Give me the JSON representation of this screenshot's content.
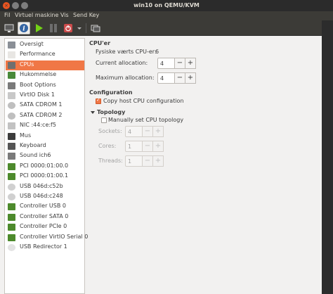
{
  "window": {
    "title": "win10 on QEMU/KVM"
  },
  "menu": [
    "Fil",
    "Virtuel maskine",
    "Vis",
    "Send Key"
  ],
  "toolbar": {
    "buttons": [
      "monitor-icon",
      "info-icon",
      "play-icon",
      "pause-icon",
      "power-icon",
      "dropdown-icon",
      "screenshot-icon"
    ]
  },
  "sidebar": {
    "items": [
      {
        "label": "Oversigt",
        "icon": "overview-icon"
      },
      {
        "label": "Performance",
        "icon": "performance-icon"
      },
      {
        "label": "CPUs",
        "icon": "cpu-icon"
      },
      {
        "label": "Hukommelse",
        "icon": "memory-icon"
      },
      {
        "label": "Boot Options",
        "icon": "boot-icon"
      },
      {
        "label": "VirtIO Disk 1",
        "icon": "disk-icon"
      },
      {
        "label": "SATA CDROM 1",
        "icon": "cdrom-icon"
      },
      {
        "label": "SATA CDROM 2",
        "icon": "cdrom-icon"
      },
      {
        "label": "NIC :44:ce:f5",
        "icon": "nic-icon"
      },
      {
        "label": "Mus",
        "icon": "mouse-icon"
      },
      {
        "label": "Keyboard",
        "icon": "keyboard-icon"
      },
      {
        "label": "Sound ich6",
        "icon": "sound-icon"
      },
      {
        "label": "PCI 0000:01:00.0",
        "icon": "pci-icon"
      },
      {
        "label": "PCI 0000:01:00.1",
        "icon": "pci-icon"
      },
      {
        "label": "USB 046d:c52b",
        "icon": "usb-icon"
      },
      {
        "label": "USB 046d:c248",
        "icon": "usb-icon"
      },
      {
        "label": "Controller USB 0",
        "icon": "controller-icon"
      },
      {
        "label": "Controller SATA 0",
        "icon": "controller-icon"
      },
      {
        "label": "Controller PCIe 0",
        "icon": "controller-icon"
      },
      {
        "label": "Controller VirtIO Serial 0",
        "icon": "controller-icon"
      },
      {
        "label": "USB Redirector 1",
        "icon": "usb-redirector-icon"
      }
    ],
    "selected": "CPUs"
  },
  "cpus": {
    "heading": "CPU'er",
    "host_cpus_label": "Fysiske værts CPU-er:",
    "host_cpus_value": "6",
    "current_label": "Current allocation:",
    "current_value": "4",
    "max_label": "Maximum allocation:",
    "max_value": "4"
  },
  "configuration": {
    "heading": "Configuration",
    "copy_host_label": "Copy host CPU configuration",
    "copy_host_checked": true
  },
  "topology": {
    "heading": "Topology",
    "manual_label": "Manually set CPU topology",
    "manual_checked": false,
    "sockets_label": "Sockets:",
    "sockets_value": "4",
    "cores_label": "Cores:",
    "cores_value": "1",
    "threads_label": "Threads:",
    "threads_value": "1"
  },
  "colors": {
    "accent": "#f07746",
    "titlebar": "#2b2b2b",
    "menubar": "#3c3b37",
    "panel": "#f2f1f0"
  }
}
